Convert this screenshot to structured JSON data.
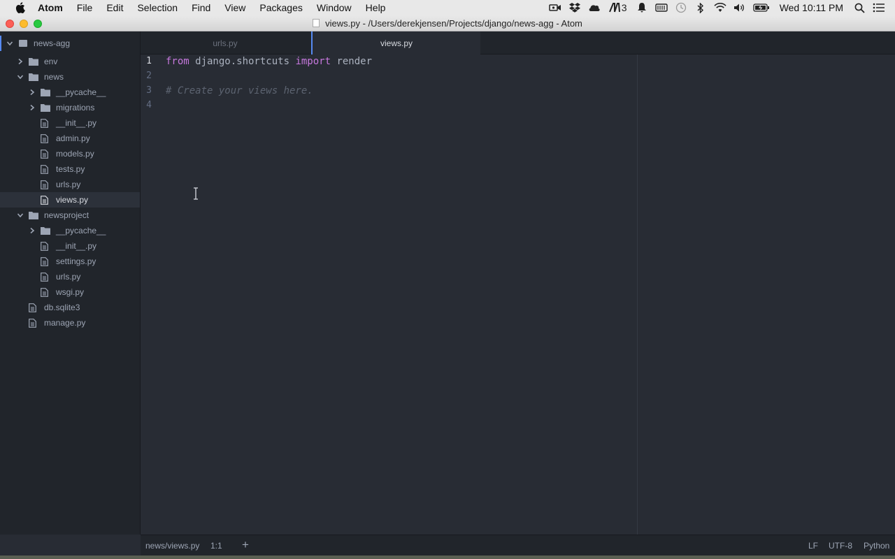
{
  "menubar": {
    "app_name": "Atom",
    "items": [
      "File",
      "Edit",
      "Selection",
      "Find",
      "View",
      "Packages",
      "Window",
      "Help"
    ],
    "adobe_count": "3",
    "clock": "Wed 10:11 PM"
  },
  "window": {
    "title": "views.py - /Users/derekjensen/Projects/django/news-agg - Atom"
  },
  "tree": {
    "root": "news-agg",
    "items": [
      {
        "label": "env",
        "type": "folder",
        "expanded": false
      },
      {
        "label": "news",
        "type": "folder",
        "expanded": true
      },
      {
        "label": "__pycache__",
        "type": "folder",
        "expanded": false
      },
      {
        "label": "migrations",
        "type": "folder",
        "expanded": false
      },
      {
        "label": "__init__.py",
        "type": "file"
      },
      {
        "label": "admin.py",
        "type": "file"
      },
      {
        "label": "models.py",
        "type": "file"
      },
      {
        "label": "tests.py",
        "type": "file"
      },
      {
        "label": "urls.py",
        "type": "file"
      },
      {
        "label": "views.py",
        "type": "file",
        "selected": true
      },
      {
        "label": "newsproject",
        "type": "folder",
        "expanded": true
      },
      {
        "label": "__pycache__",
        "type": "folder",
        "expanded": false
      },
      {
        "label": "__init__.py",
        "type": "file"
      },
      {
        "label": "settings.py",
        "type": "file"
      },
      {
        "label": "urls.py",
        "type": "file"
      },
      {
        "label": "wsgi.py",
        "type": "file"
      },
      {
        "label": "db.sqlite3",
        "type": "file"
      },
      {
        "label": "manage.py",
        "type": "file"
      }
    ]
  },
  "tabs": [
    {
      "label": "urls.py",
      "active": false
    },
    {
      "label": "views.py",
      "active": true
    }
  ],
  "editor": {
    "line_numbers": [
      "1",
      "2",
      "3",
      "4"
    ],
    "line1": {
      "kw1": "from",
      "module": " django.shortcuts ",
      "kw2": "import",
      "name": " render"
    },
    "line3_comment": "# Create your views here."
  },
  "statusbar": {
    "file_path": "news/views.py",
    "cursor": "1:1",
    "add": "+",
    "line_ending": "LF",
    "encoding": "UTF-8",
    "grammar": "Python"
  },
  "colors": {
    "accent": "#568af2",
    "keyword": "#c678dd",
    "comment": "#5c6370",
    "background": "#282c34",
    "panel": "#21252b"
  }
}
